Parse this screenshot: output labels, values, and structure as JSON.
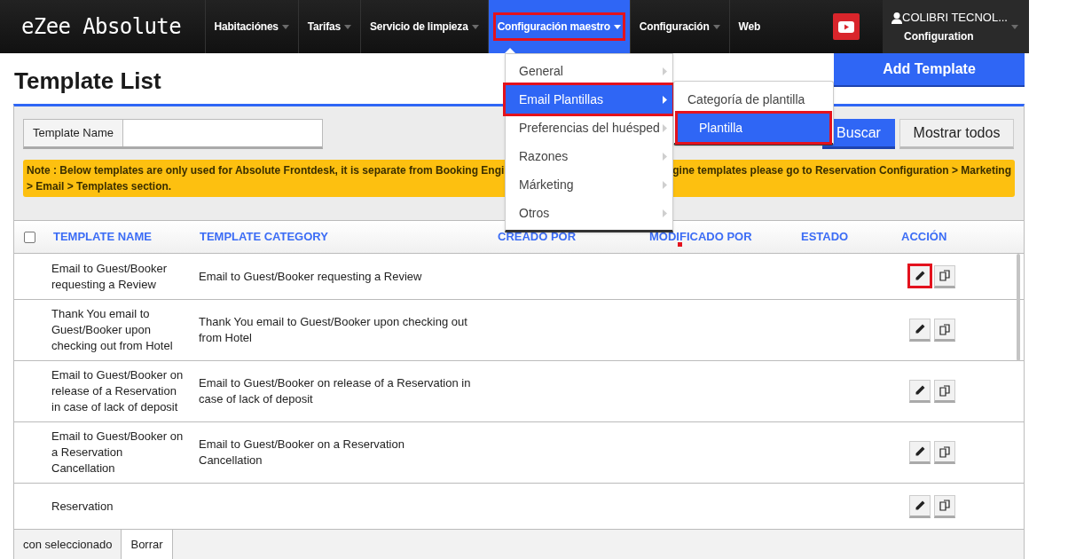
{
  "app": {
    "logo": "eZee Absolute"
  },
  "nav": [
    {
      "label": "Habitaciónes",
      "dropdown": true,
      "selected": false,
      "highlighted": false
    },
    {
      "label": "Tarifas",
      "dropdown": true,
      "selected": false,
      "highlighted": false
    },
    {
      "label": "Servicio de limpieza",
      "dropdown": true,
      "selected": false,
      "highlighted": false
    },
    {
      "label": "Configuración maestro",
      "dropdown": true,
      "selected": true,
      "highlighted": true
    },
    {
      "label": "Configuración",
      "dropdown": true,
      "selected": false,
      "highlighted": false
    },
    {
      "label": "Web",
      "dropdown": false,
      "selected": false,
      "highlighted": false
    }
  ],
  "user": {
    "name": "COLIBRI TECNOL...",
    "role": "Configuration"
  },
  "menu": [
    {
      "label": "General",
      "selected": false,
      "highlighted": false
    },
    {
      "label": "Email Plantillas",
      "selected": true,
      "highlighted": true
    },
    {
      "label": "Preferencias del huésped",
      "selected": false,
      "highlighted": false
    },
    {
      "label": "Razones",
      "selected": false,
      "highlighted": false
    },
    {
      "label": "Márketing",
      "selected": false,
      "highlighted": false
    },
    {
      "label": "Otros",
      "selected": false,
      "highlighted": false
    }
  ],
  "submenu": [
    {
      "label": "Categoría de plantilla",
      "selected": false,
      "highlighted": false
    },
    {
      "label": "Plantilla",
      "selected": true,
      "highlighted": true
    }
  ],
  "page": {
    "title": "Template List",
    "add_button": "Add Template"
  },
  "search": {
    "label": "Template Name",
    "search_button": "Buscar",
    "show_all_button": "Mostrar todos"
  },
  "note": {
    "line_1_start": "Note : Below templates are only used for Absolute Frontdesk, it is separate from Booking Engi",
    "line_1_end": "gine templates please go to Reservation Configuration > Marketing",
    "line_2": "> Email > Templates section."
  },
  "table": {
    "select_all": {
      "checked": false
    },
    "columns": [
      {
        "label": "TEMPLATE NAME",
        "marked": false
      },
      {
        "label": "TEMPLATE CATEGORY",
        "marked": false
      },
      {
        "label": "CREADO POR",
        "marked": false
      },
      {
        "label": "MODIFICADO POR",
        "marked": true
      },
      {
        "label": "ESTADO",
        "marked": false
      },
      {
        "label": "ACCIÓN",
        "marked": false
      }
    ],
    "rows": [
      {
        "name": "Email to Guest/Booker requesting a Review",
        "category": "Email to Guest/Booker requesting a Review",
        "edit_highlighted": true
      },
      {
        "name": "Thank You email to Guest/Booker upon checking out from Hotel",
        "category": "Thank You email to Guest/Booker upon checking out from Hotel",
        "edit_highlighted": false
      },
      {
        "name": "Email to Guest/Booker on release of a Reservation in case of lack of deposit",
        "category": "Email to Guest/Booker on release of a Reservation in case of lack of deposit",
        "edit_highlighted": false
      },
      {
        "name": "Email to Guest/Booker on a Reservation Cancellation",
        "category": "Email to Guest/Booker on a Reservation Cancellation",
        "edit_highlighted": false
      },
      {
        "name": "Reservation",
        "category": "",
        "edit_highlighted": false
      }
    ]
  },
  "footer": {
    "label": "con seleccionado",
    "delete_button": "Borrar"
  }
}
